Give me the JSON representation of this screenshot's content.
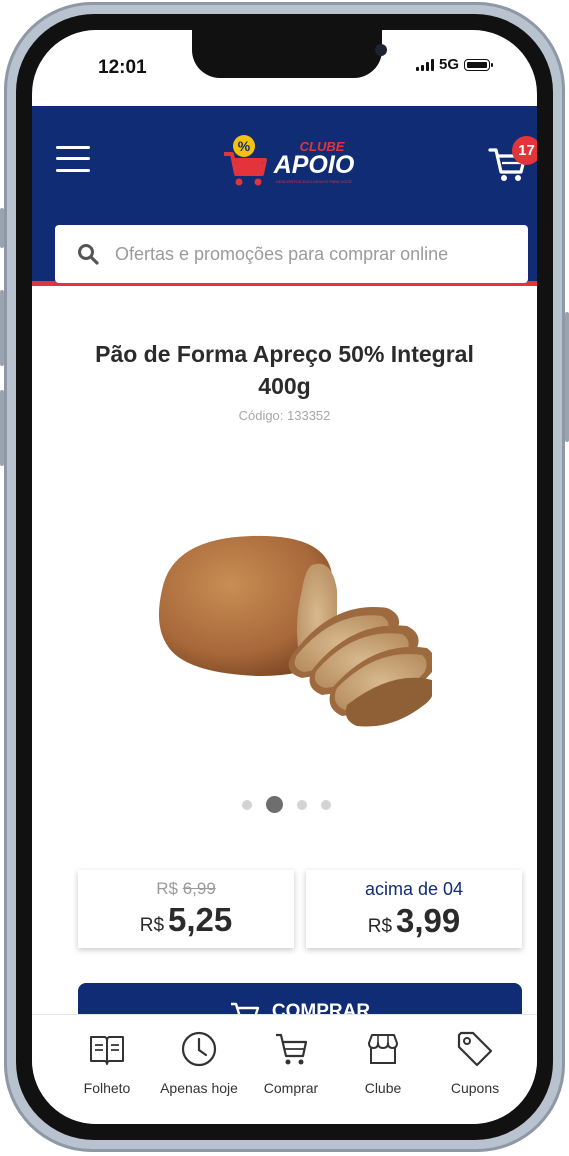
{
  "status_bar": {
    "time": "12:01",
    "network": "5G"
  },
  "header": {
    "menu_icon": "hamburger-menu-icon",
    "logo": {
      "top_text": "CLUBE",
      "main_text": "APOIO",
      "tagline": "DESCONTOS EXCLUSIVOS PARA VOCÊ",
      "icon": "shopping-cart-percent-logo"
    },
    "cart": {
      "icon": "shopping-cart-icon",
      "count": "17"
    },
    "search": {
      "placeholder": "Ofertas e promoções para comprar online",
      "value": ""
    },
    "colors": {
      "primary": "#0f2c75",
      "accent": "#e3343b"
    }
  },
  "product": {
    "title": "Pão de Forma Apreço 50% Integral 400g",
    "code": "Código: 133352",
    "image": "sliced-whole-wheat-bread-image",
    "carousel": {
      "count": 4,
      "active_index": 1
    }
  },
  "prices": {
    "regular": {
      "currency": "R$",
      "old_value": "6,99",
      "value": "5,25"
    },
    "bulk": {
      "label": "acima de 04",
      "currency": "R$",
      "value": "3,99"
    }
  },
  "buy_button": {
    "label": "COMPRAR",
    "icon": "cart-icon"
  },
  "tab_bar": {
    "items": [
      {
        "label": "Folheto",
        "icon": "flyer-icon"
      },
      {
        "label": "Apenas hoje",
        "icon": "clock-icon"
      },
      {
        "label": "Comprar",
        "icon": "cart-icon"
      },
      {
        "label": "Clube",
        "icon": "store-icon"
      },
      {
        "label": "Cupons",
        "icon": "tag-icon"
      }
    ]
  }
}
